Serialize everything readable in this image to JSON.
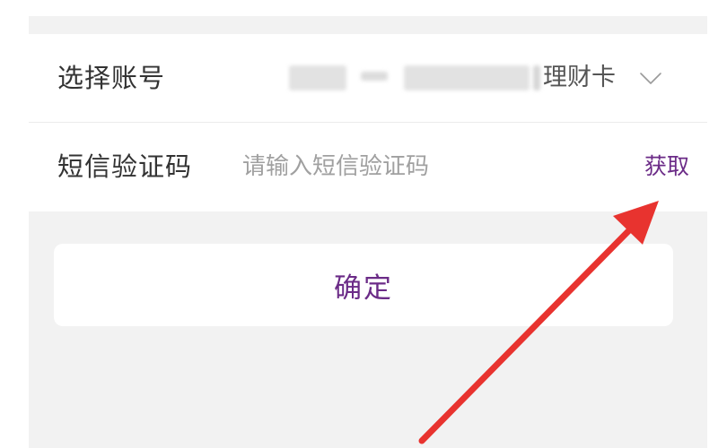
{
  "account_row": {
    "label": "选择账号",
    "value_visible_suffix": "理财卡",
    "icon": "chevron-down-icon"
  },
  "sms_row": {
    "label": "短信验证码",
    "input_value": "",
    "input_placeholder": "请输入短信验证码",
    "get_code_label": "获取"
  },
  "confirm": {
    "label": "确定"
  },
  "colors": {
    "accent": "#6b2b87",
    "annotation_arrow": "#e8332f",
    "background_gray": "#f2f2f2",
    "text_primary": "#333333",
    "text_placeholder": "#a0a0a0"
  }
}
